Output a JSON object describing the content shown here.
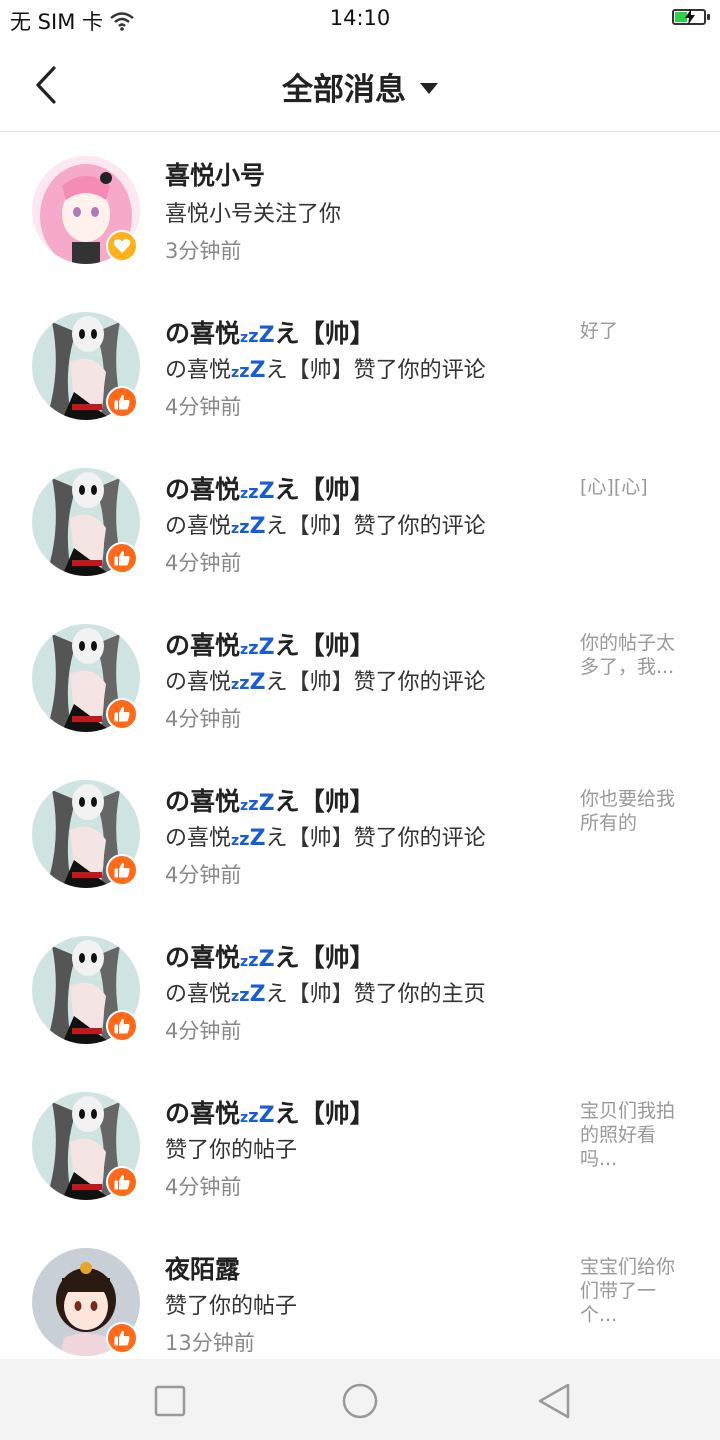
{
  "status_bar": {
    "carrier": "无 SIM 卡",
    "time": "14:10"
  },
  "header": {
    "title": "全部消息"
  },
  "messages": [
    {
      "name": "喜悦小号",
      "name_suffix": "",
      "description": "喜悦小号关注了你",
      "time": "3分钟前",
      "preview": "",
      "badge": "heart",
      "avatar": "pink-hair-avatar"
    },
    {
      "name": "の喜悦",
      "name_suffix": "え【帅】",
      "description_prefix": "の喜悦",
      "description": "え【帅】赞了你的评论",
      "time": "4分钟前",
      "preview": "好了",
      "badge": "thumbs-up",
      "avatar": "dark-anime-avatar"
    },
    {
      "name": "の喜悦",
      "name_suffix": "え【帅】",
      "description_prefix": "の喜悦",
      "description": "え【帅】赞了你的评论",
      "time": "4分钟前",
      "preview": "[心][心]",
      "badge": "thumbs-up",
      "avatar": "dark-anime-avatar"
    },
    {
      "name": "の喜悦",
      "name_suffix": "え【帅】",
      "description_prefix": "の喜悦",
      "description": "え【帅】赞了你的评论",
      "time": "4分钟前",
      "preview": "你的帖子太多了，我...",
      "badge": "thumbs-up",
      "avatar": "dark-anime-avatar"
    },
    {
      "name": "の喜悦",
      "name_suffix": "え【帅】",
      "description_prefix": "の喜悦",
      "description": "え【帅】赞了你的评论",
      "time": "4分钟前",
      "preview": "你也要给我所有的",
      "badge": "thumbs-up",
      "avatar": "dark-anime-avatar"
    },
    {
      "name": "の喜悦",
      "name_suffix": "え【帅】",
      "description_prefix": "の喜悦",
      "description": "え【帅】赞了你的主页",
      "time": "4分钟前",
      "preview": "",
      "badge": "thumbs-up",
      "avatar": "dark-anime-avatar"
    },
    {
      "name": "の喜悦",
      "name_suffix": "え【帅】",
      "description": "赞了你的帖子",
      "time": "4分钟前",
      "preview": "宝贝们我拍的照好看吗...",
      "badge": "thumbs-up",
      "avatar": "dark-anime-avatar"
    },
    {
      "name": "夜陌露",
      "name_suffix": "",
      "description": "赞了你的帖子",
      "time": "13分钟前",
      "preview": "宝宝们给你们带了一个...",
      "badge": "thumbs-up",
      "avatar": "girl-avatar"
    }
  ],
  "nav_bar": {
    "icons": [
      "recent-apps-icon",
      "home-icon",
      "back-nav-icon"
    ]
  },
  "colors": {
    "badge_orange": "#ff6a1a",
    "badge_yellow": "#ffb11b",
    "zzz_blue": "#1a5bd6"
  }
}
